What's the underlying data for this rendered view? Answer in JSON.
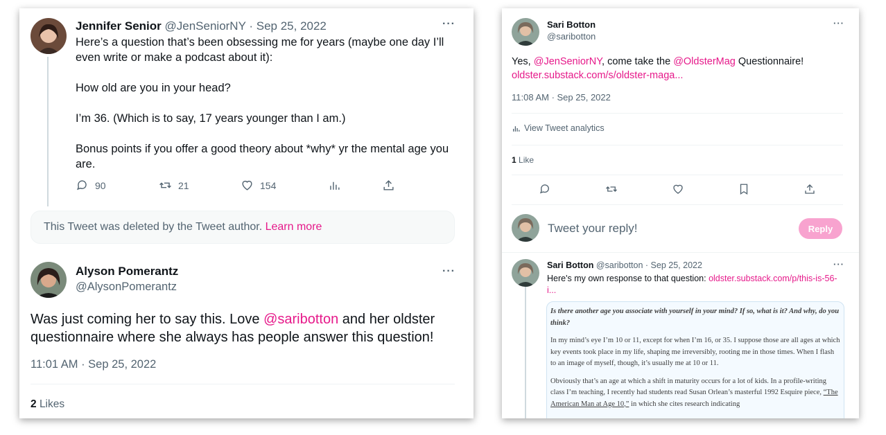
{
  "left": {
    "tweet1": {
      "name": "Jennifer Senior",
      "handle": "@JenSeniorNY",
      "date": "· Sep 25, 2022",
      "body": [
        "Here’s a question that’s been obsessing me for years (maybe one day I’ll even write or make a podcast about it):",
        "How old are you in your head?",
        "I’m 36. (Which is to say, 17 years younger than I am.)",
        "Bonus points if you offer a good theory about *why* yr the mental age you are."
      ],
      "replies": "90",
      "retweets": "21",
      "likes": "154"
    },
    "deleted": {
      "text": "This Tweet was deleted by the Tweet author.",
      "link": "Learn more"
    },
    "tweet2": {
      "name": "Alyson Pomerantz",
      "handle": "@AlysonPomerantz",
      "body_before": "Was just coming her to say this. Love ",
      "mention": "@saribotton",
      "body_after": " and her oldster questionnaire where she always has people answer this question!",
      "time": "11:01 AM · Sep 25, 2022",
      "likes_count": "2",
      "likes_label": "Likes"
    }
  },
  "right": {
    "main": {
      "name": "Sari Botton",
      "handle": "@saribotton",
      "text_1": "Yes, ",
      "mention_1": "@JenSeniorNY",
      "text_2": ", come take the ",
      "mention_2": "@OldsterMag",
      "text_3": " Questionnaire!",
      "link": "oldster.substack.com/s/oldster-maga...",
      "time": "11:08 AM · Sep 25, 2022",
      "analytics": "View Tweet analytics",
      "likes_count": "1",
      "likes_label": "Like"
    },
    "reply_box": {
      "placeholder": "Tweet your reply!",
      "button": "Reply"
    },
    "reply": {
      "name": "Sari Botton",
      "handle": "@saribotton",
      "date": "· Sep 25, 2022",
      "text": "Here's my own response to that question: ",
      "link": "oldster.substack.com/p/this-is-56-i..."
    },
    "quote": {
      "question": "Is there another age you associate with yourself in your mind? If so, what is it? And why, do you think?",
      "para1": "In my mind’s eye I’m 10 or 11, except for when I’m 16, or 35. I suppose those are all ages at which key events took place in my life, shaping me irreversibly, rooting me in those times. When I flash to an image of myself, though, it’s usually me at 10 or 11.",
      "para2_before": "Obviously that’s an age at which a shift in maturity occurs for a lot of kids. In a profile-writing class I’m teaching, I recently had students read Susan Orlean’s masterful 1992 Esquire piece, ",
      "para2_link": "“The American Man at Age 10,”",
      "para2_after": " in which she cites research indicating"
    }
  }
}
